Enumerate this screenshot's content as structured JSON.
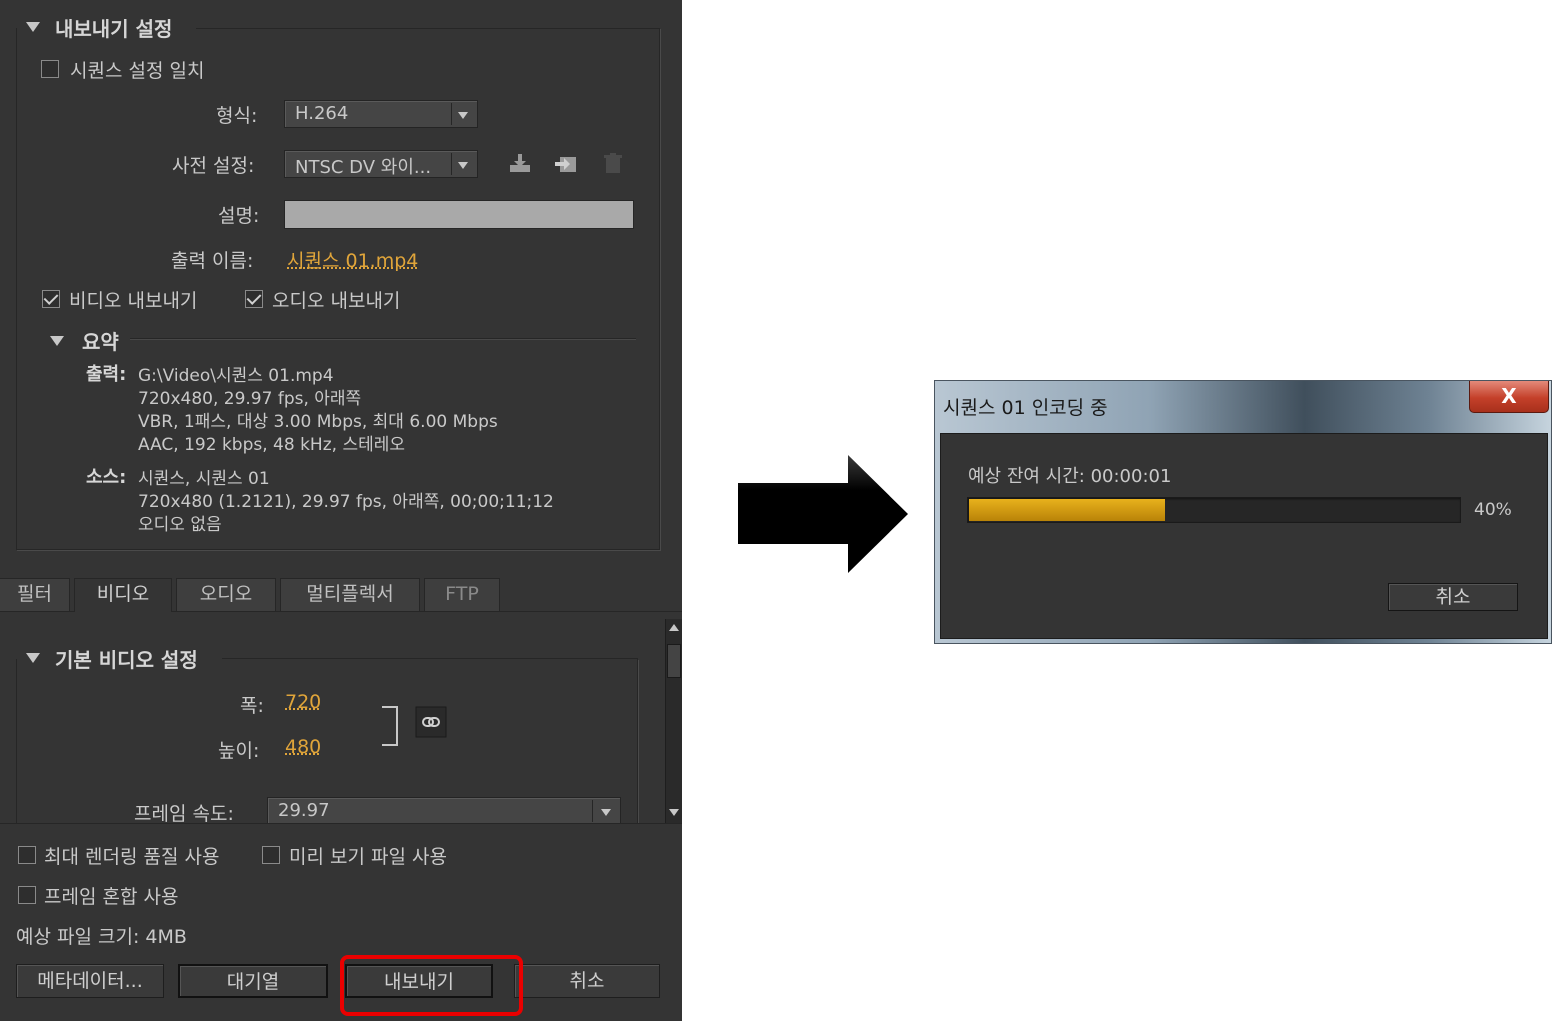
{
  "export_settings": {
    "section_title": "내보내기 설정",
    "match_sequence_label": "시퀀스 설정 일치",
    "format_label": "형식:",
    "format_value": "H.264",
    "preset_label": "사전 설정:",
    "preset_value": "NTSC DV 와이...",
    "comments_label": "설명:",
    "comments_value": "",
    "output_name_label": "출력 이름:",
    "output_name_value": "시퀀스 01.mp4",
    "export_video_label": "비디오 내보내기",
    "export_video_checked": true,
    "export_audio_label": "오디오 내보내기",
    "export_audio_checked": true
  },
  "summary": {
    "title": "요약",
    "output_label": "출력:",
    "output_lines": [
      "G:\\Video\\시퀀스 01.mp4",
      "720x480, 29.97 fps, 아래쪽",
      "VBR, 1패스, 대상 3.00 Mbps, 최대 6.00 Mbps",
      "AAC, 192 kbps, 48 kHz, 스테레오"
    ],
    "source_label": "소스:",
    "source_lines": [
      "시퀀스, 시퀀스 01",
      "720x480 (1.2121), 29.97 fps, 아래쪽, 00;00;11;12",
      "오디오 없음"
    ]
  },
  "tabs": [
    "필터",
    "비디오",
    "오디오",
    "멀티플렉서",
    "FTP"
  ],
  "active_tab": "비디오",
  "basic_video": {
    "title": "기본 비디오 설정",
    "width_label": "폭:",
    "width_value": "720",
    "height_label": "높이:",
    "height_value": "480",
    "frame_rate_label": "프레임 속도:",
    "frame_rate_value": "29.97"
  },
  "bottom": {
    "max_render_label": "최대 렌더링 품질 사용",
    "preview_files_label": "미리 보기 파일 사용",
    "frame_blend_label": "프레임 혼합 사용",
    "file_size_text": "예상 파일 크기: 4MB",
    "metadata_button": "메타데이터...",
    "queue_button": "대기열",
    "export_button": "내보내기",
    "cancel_button": "취소"
  },
  "dialog": {
    "title": "시퀀스 01 인코딩 중",
    "close_label": "X",
    "remaining_text": "예상 잔여 시간: 00:00:01",
    "progress_percent": 40,
    "progress_text": "40%",
    "cancel_button": "취소"
  },
  "colors": {
    "panel_bg": "#343434",
    "link": "#e0a53a",
    "progress": "#d9a010",
    "highlight": "#ea0000"
  }
}
